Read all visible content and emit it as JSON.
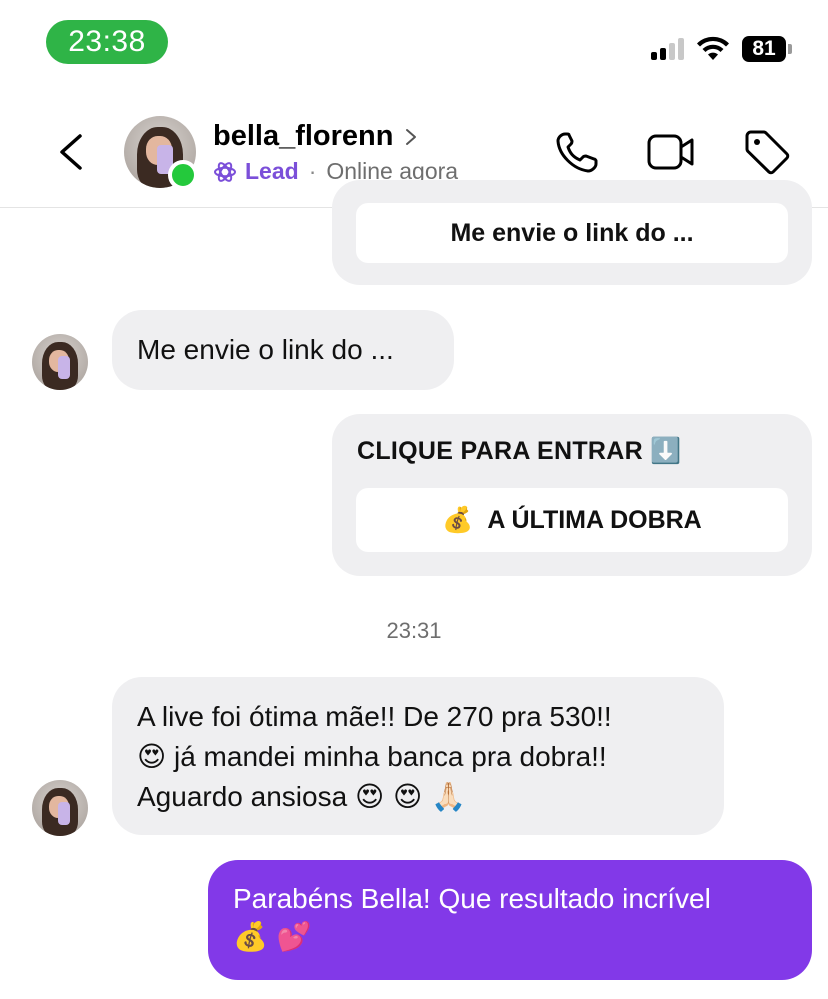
{
  "status_bar": {
    "time": "23:38",
    "battery": "81"
  },
  "header": {
    "username": "bella_florenn",
    "label": "Lead",
    "separator": "·",
    "status": "Online agora"
  },
  "messages": {
    "card1": {
      "button": "Me envie o link do ..."
    },
    "incoming1": {
      "text": "Me envie o link do ..."
    },
    "card2": {
      "heading": "CLIQUE PARA ENTRAR",
      "heading_emoji": "⬇️",
      "button_emoji": "💰",
      "button": "A ÚLTIMA DOBRA"
    },
    "timestamp": "23:31",
    "incoming2": {
      "line1": "A live foi ótima mãe!! De 270 pra 530!!",
      "line2_emoji": "😍",
      "line2": "já mandei minha banca pra dobra!!",
      "line3": "Aguardo ansiosa",
      "line3_emoji": "😍 😍 🙏🏻"
    },
    "outgoing1": {
      "line1": "Parabéns Bella! Que resultado incrível",
      "line2_emoji": "💰 💕"
    }
  },
  "colors": {
    "accent_purple": "#8239e8",
    "lead_purple": "#7b4fd9",
    "status_green": "#2fb447",
    "online_green": "#24c93c",
    "bubble_gray": "#efeff1"
  },
  "icons": [
    "back-chevron-icon",
    "chevron-right-icon",
    "lead-icon",
    "phone-icon",
    "video-icon",
    "tag-icon",
    "signal-icon",
    "wifi-icon",
    "battery-icon"
  ]
}
